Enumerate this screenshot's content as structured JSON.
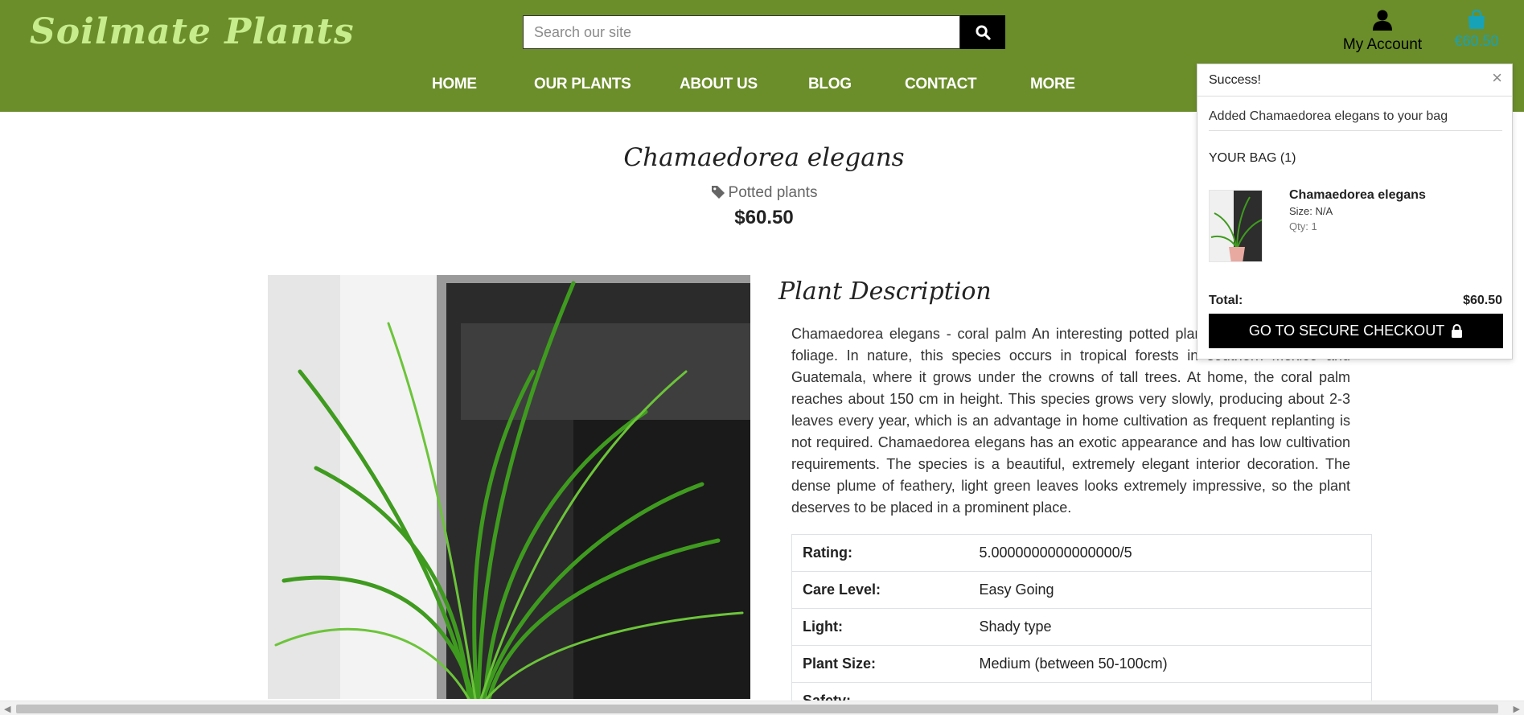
{
  "header": {
    "logo": "Soilmate Plants",
    "search_placeholder": "Search our site",
    "account_label": "My Account",
    "bag_total": "€60.50",
    "nav": [
      "HOME",
      "OUR PLANTS",
      "ABOUT US",
      "BLOG",
      "CONTACT",
      "MORE"
    ]
  },
  "product": {
    "title": "Chamaedorea elegans",
    "category": "Potted plants",
    "price": "$60.50",
    "description_heading": "Plant Description",
    "description": "Chamaedorea elegans - coral palm An interesting potted plant with graceful pinnate foliage. In nature, this species occurs in tropical forests in southern Mexico and Guatemala, where it grows under the crowns of tall trees. At home, the coral palm reaches about 150 cm in height. This species grows very slowly, producing about 2-3 leaves every year, which is an advantage in home cultivation as frequent replanting is not required. Chamaedorea elegans has an exotic appearance and has low cultivation requirements. The species is a beautiful, extremely elegant interior decoration. The dense plume of feathery, light green leaves looks extremely impressive, so the plant deserves to be placed in a prominent place.",
    "specs": [
      {
        "label": "Rating:",
        "value": "5.0000000000000000/5"
      },
      {
        "label": "Care Level:",
        "value": "Easy Going"
      },
      {
        "label": "Light:",
        "value": "Shady type"
      },
      {
        "label": "Plant Size:",
        "value": "Medium (between 50-100cm)"
      },
      {
        "label": "Safety:",
        "value": ""
      }
    ]
  },
  "toast": {
    "title": "Success!",
    "close": "×",
    "message": "Added Chamaedorea elegans to your bag",
    "bag_heading": "YOUR BAG (1)",
    "item_name": "Chamaedorea elegans",
    "item_size": "Size: N/A",
    "item_qty": "Qty: 1",
    "total_label": "Total:",
    "total_value": "$60.50",
    "checkout_label": "GO TO SECURE CHECKOUT"
  },
  "colors": {
    "header_bg": "#6b8e2a",
    "logo": "#c6ec8c",
    "bag_accent": "#17a2b8"
  },
  "icons": [
    "search-icon",
    "user-icon",
    "shopping-bag-icon",
    "tag-icon",
    "close-icon",
    "lock-icon"
  ]
}
